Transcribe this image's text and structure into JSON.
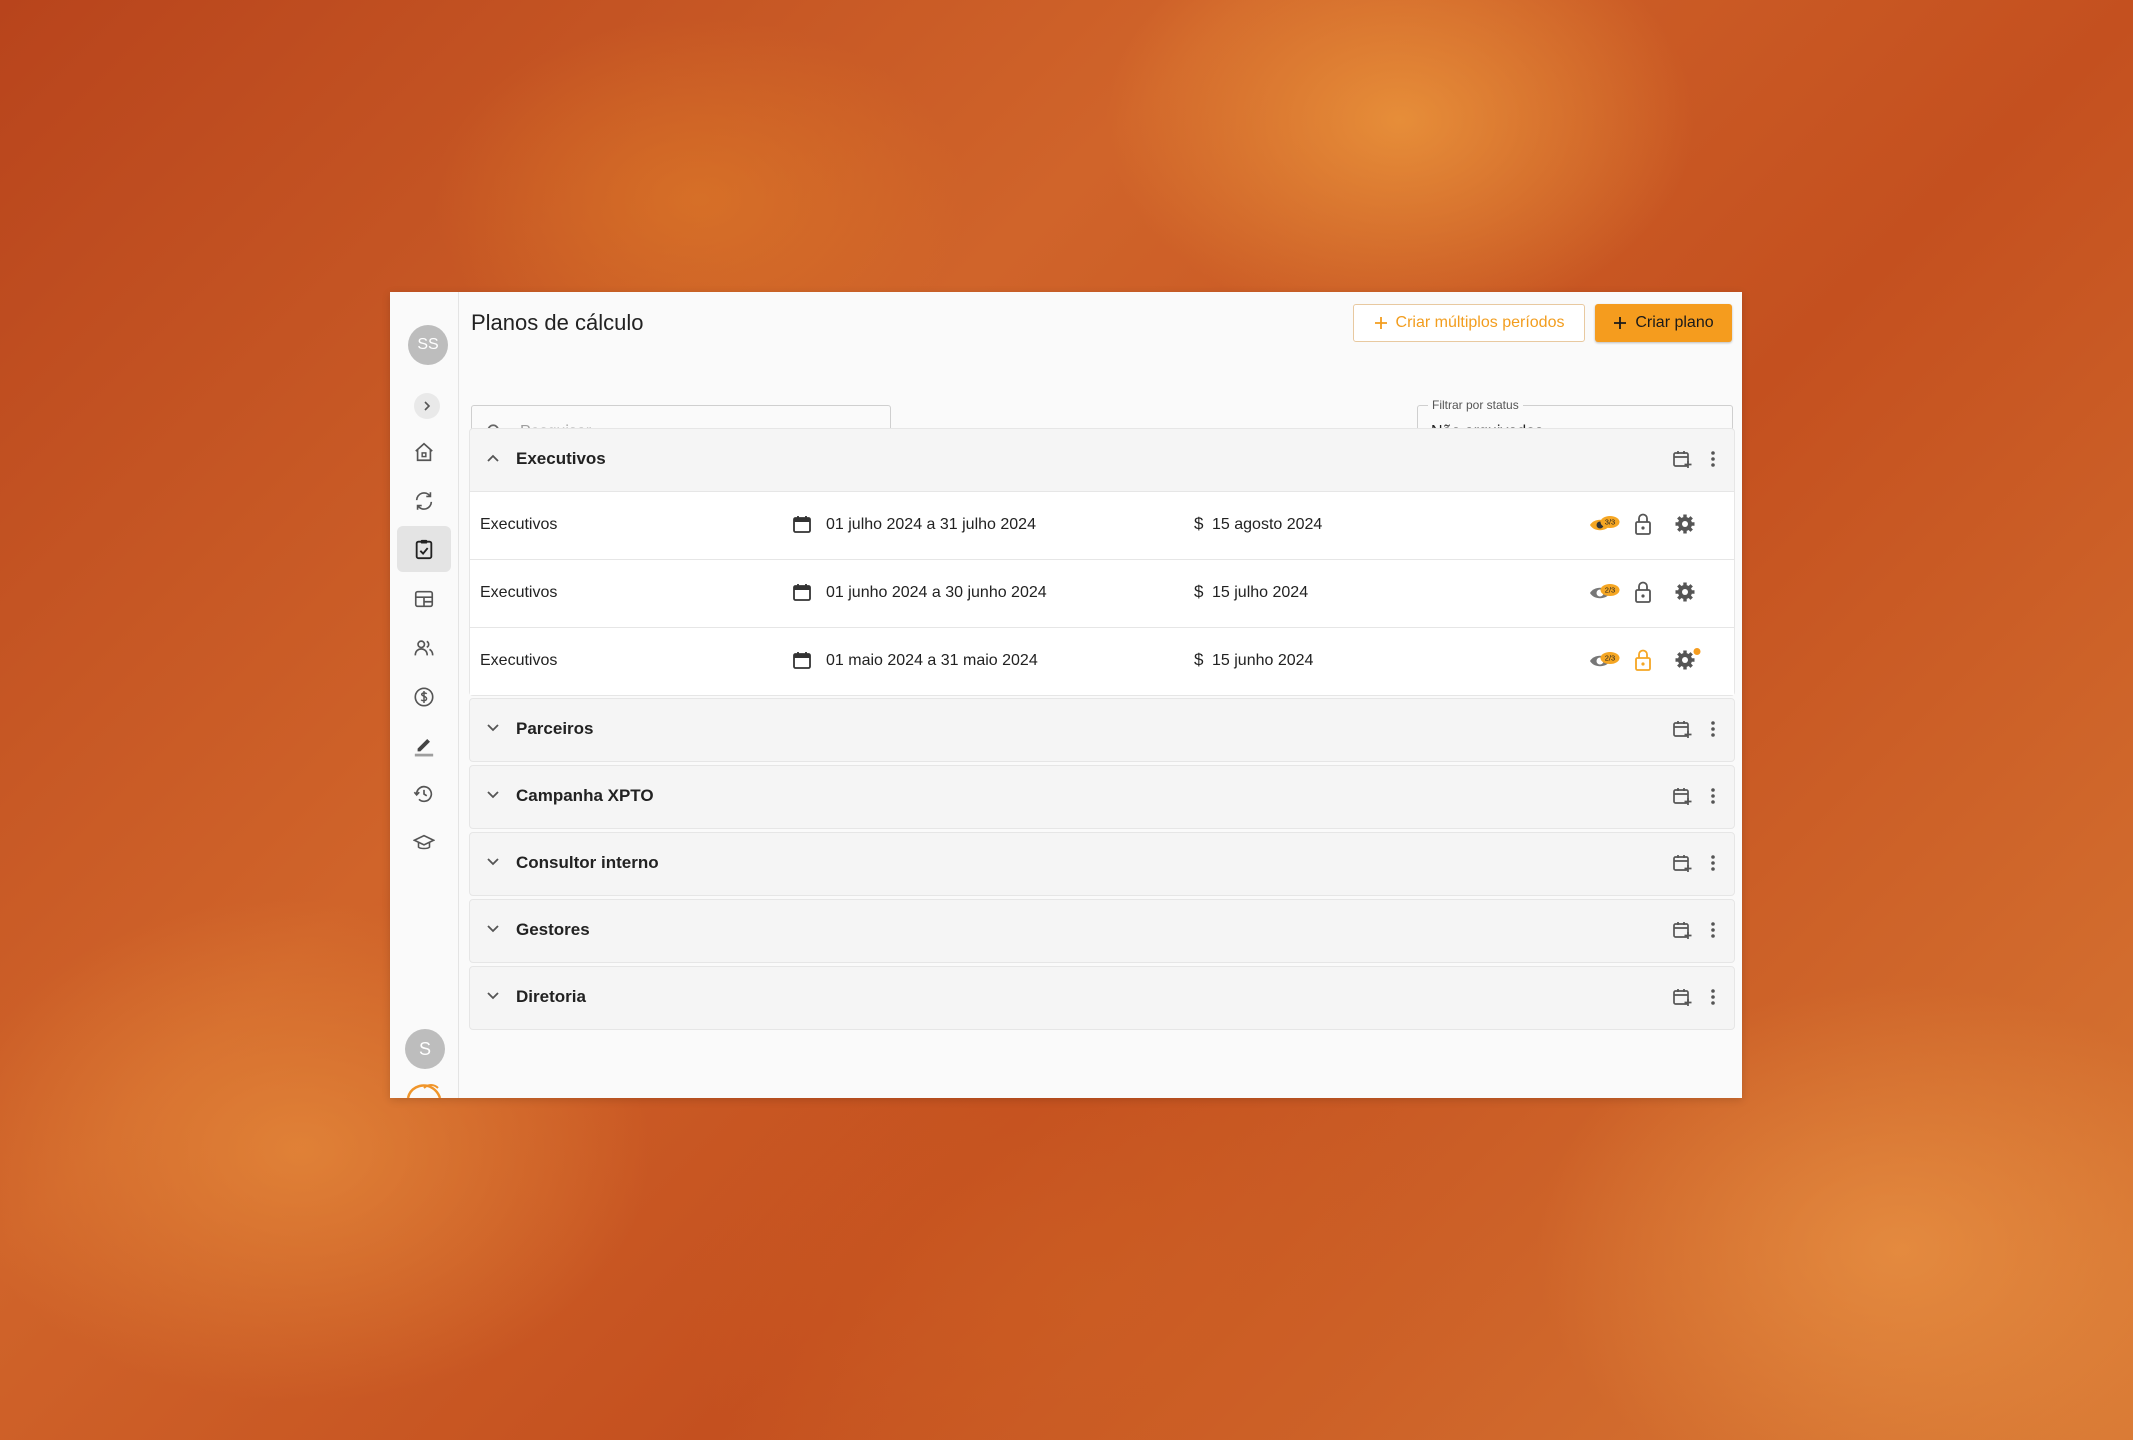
{
  "sidebar": {
    "user_initials": "SS",
    "bottom_initial": "S",
    "nav_icons": [
      "home-icon",
      "sync-icon",
      "clipboard-icon",
      "dashboard-icon",
      "people-icon",
      "dollar-icon",
      "edit-icon",
      "history-icon",
      "school-icon"
    ],
    "active_index": 2
  },
  "header": {
    "title": "Planos de cálculo",
    "btn_multi_label": "Criar múltiplos períodos",
    "btn_create_label": "Criar plano"
  },
  "search": {
    "placeholder": "Pesquisar",
    "value": ""
  },
  "status_filter": {
    "label": "Filtrar por status",
    "value": "Não arquivados"
  },
  "colors": {
    "accent": "#f59c1e",
    "accent_text": "#f29d1e",
    "badge_dot": "#f59c1e"
  },
  "groups": [
    {
      "title": "Executivos",
      "expanded": true,
      "rows": [
        {
          "name": "Executivos",
          "period": "01 julho 2024 a 31 julho 2024",
          "currency": "$",
          "pay_date": "15 agosto 2024",
          "badge": "3/3",
          "locked_highlight": false,
          "settings_dot": false
        },
        {
          "name": "Executivos",
          "period": "01 junho 2024 a 30 junho 2024",
          "currency": "$",
          "pay_date": "15 julho 2024",
          "badge": "2/3",
          "locked_highlight": false,
          "settings_dot": false
        },
        {
          "name": "Executivos",
          "period": "01 maio 2024 a 31 maio 2024",
          "currency": "$",
          "pay_date": "15 junho 2024",
          "badge": "2/3",
          "locked_highlight": true,
          "settings_dot": true
        }
      ]
    },
    {
      "title": "Parceiros",
      "expanded": false
    },
    {
      "title": "Campanha XPTO",
      "expanded": false
    },
    {
      "title": "Consultor interno",
      "expanded": false
    },
    {
      "title": "Gestores",
      "expanded": false
    },
    {
      "title": "Diretoria",
      "expanded": false
    }
  ]
}
